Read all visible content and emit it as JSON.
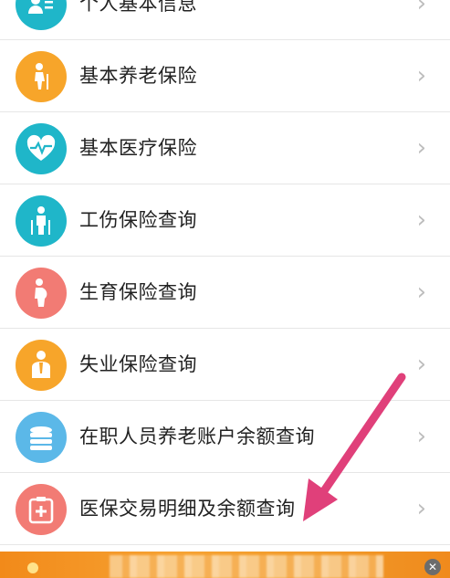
{
  "items": [
    {
      "label": "个人基本信息",
      "icon": "person-card-icon",
      "color": "#1fb6c9"
    },
    {
      "label": "基本养老保险",
      "icon": "elderly-person-icon",
      "color": "#f7a52a"
    },
    {
      "label": "基本医疗保险",
      "icon": "heart-pulse-icon",
      "color": "#1fb6c9"
    },
    {
      "label": "工伤保险查询",
      "icon": "injured-worker-icon",
      "color": "#1fb6c9"
    },
    {
      "label": "生育保险查询",
      "icon": "pregnant-woman-icon",
      "color": "#f27b74"
    },
    {
      "label": "失业保险查询",
      "icon": "unemployed-worker-icon",
      "color": "#f7a52a"
    },
    {
      "label": "在职人员养老账户余额查询",
      "icon": "coin-stack-icon",
      "color": "#5bb8e8"
    },
    {
      "label": "医保交易明细及余额查询",
      "icon": "medical-kit-icon",
      "color": "#f27b74"
    }
  ],
  "chevron": "›",
  "banner": {
    "close_symbol": "✕",
    "color": "#f39a28"
  },
  "annotation_arrow": {
    "color": "#e0407a",
    "points_to": "医保交易明细及余额查询"
  }
}
